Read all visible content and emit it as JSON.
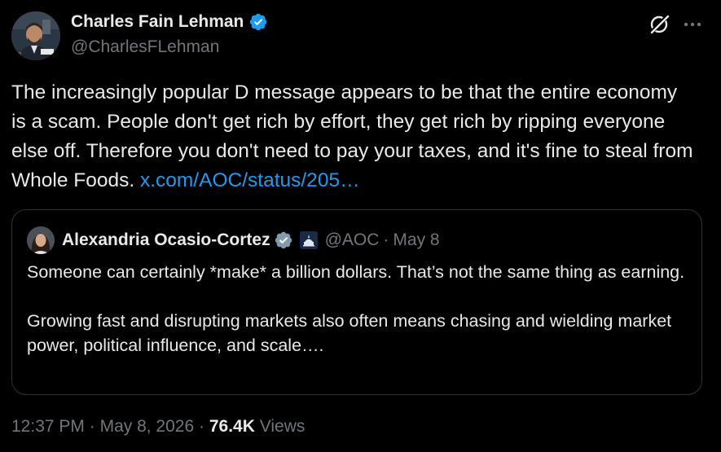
{
  "author": {
    "name": "Charles Fain Lehman",
    "handle": "@CharlesFLehman",
    "verified_color": "#1d9bf0"
  },
  "tweet": {
    "text": "The increasingly popular D message appears to be that the entire economy is a scam. People don't get rich by effort, they get rich by ripping everyone else off. Therefore you don't need to pay your taxes, and it's fine to steal from Whole Foods.",
    "link_text": "x.com/AOC/status/205…"
  },
  "quoted": {
    "name": "Alexandria Ocasio-Cortez",
    "handle": "@AOC",
    "separator": "·",
    "date": "May 8",
    "paragraphs": [
      "Someone can certainly *make* a billion dollars. That’s not the same thing as earning.",
      "Growing fast and disrupting markets also often means chasing and wielding market power, political influence, and scale…."
    ],
    "verified_color": "#829aab"
  },
  "meta": {
    "time": "12:37 PM",
    "sep1": "·",
    "date": "May 8, 2026",
    "sep2": "·",
    "views_count": "76.4K",
    "views_label": "Views"
  },
  "icons": {
    "grok": "grok-icon",
    "more": "more-icon",
    "verified": "verified-badge-icon",
    "affiliation": "capitol-affiliation-icon"
  },
  "colors": {
    "background": "#000000",
    "text": "#e7e9ea",
    "secondary": "#71767b",
    "link": "#1d9bf0",
    "border": "#2f3336"
  }
}
